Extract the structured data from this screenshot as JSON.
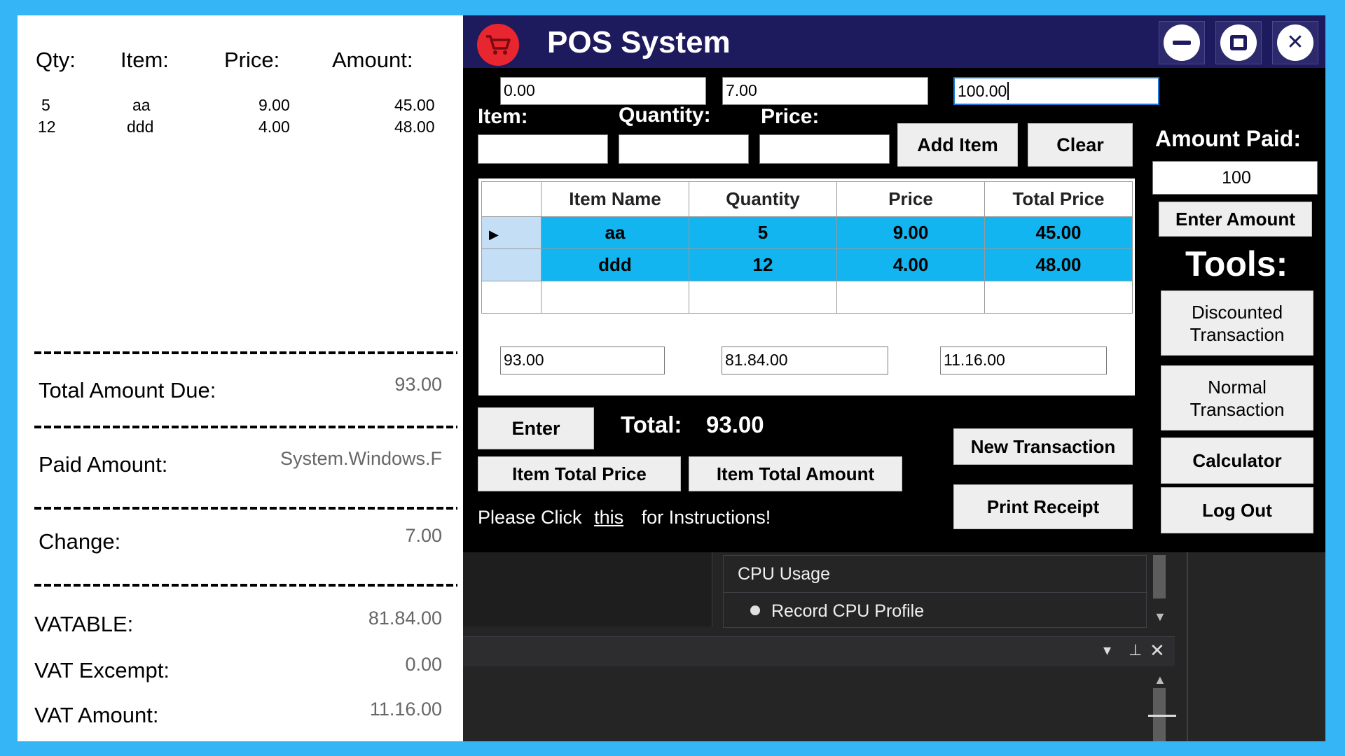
{
  "receipt": {
    "headers": {
      "qty": "Qty:",
      "item": "Item:",
      "price": "Price:",
      "amount": "Amount:"
    },
    "lines": [
      {
        "qty": "5",
        "item": "aa",
        "price": "9.00",
        "amount": "45.00"
      },
      {
        "qty": "12",
        "item": "ddd",
        "price": "4.00",
        "amount": "48.00"
      }
    ],
    "total_due_label": "Total Amount Due:",
    "total_due_value": "93.00",
    "paid_label": "Paid Amount:",
    "paid_value": "System.Windows.F",
    "change_label": "Change:",
    "change_value": "7.00",
    "vatable_label": "VATABLE:",
    "vatable_value": "81.84.00",
    "vat_exempt_label": "VAT Excempt:",
    "vat_exempt_value": "0.00",
    "vat_amount_label": "VAT Amount:",
    "vat_amount_value": "11.16.00"
  },
  "window": {
    "title": "POS System",
    "top_fields": [
      "0.00",
      "7.00",
      "100.00"
    ],
    "labels": {
      "item": "Item:",
      "quantity": "Quantity:",
      "price": "Price:",
      "amount_paid": "Amount Paid:",
      "tools": "Tools:",
      "total": "Total:"
    },
    "inputs": {
      "item": "",
      "quantity": "",
      "price": "",
      "amount_paid": "100"
    },
    "buttons": {
      "add_item": "Add Item",
      "clear": "Clear",
      "enter_amount": "Enter Amount",
      "discounted": "Discounted\nTransaction",
      "normal": "Normal\nTransaction",
      "calculator": "Calculator",
      "logout": "Log Out",
      "enter": "Enter",
      "item_total_price": "Item Total Price",
      "item_total_amount": "Item Total Amount",
      "new_transaction": "New Transaction",
      "print_receipt": "Print Receipt"
    },
    "grid": {
      "columns": [
        "Item Name",
        "Quantity",
        "Price",
        "Total Price"
      ],
      "rows": [
        [
          "aa",
          "5",
          "9.00",
          "45.00"
        ],
        [
          "ddd",
          "12",
          "4.00",
          "48.00"
        ]
      ]
    },
    "summary_fields": [
      "93.00",
      "81.84.00",
      "11.16.00"
    ],
    "total_value": "93.00",
    "instructions": {
      "prefix": "Please Click",
      "link": "this",
      "suffix": "for Instructions!"
    }
  },
  "background": {
    "cpu_usage": "CPU Usage",
    "record_cpu": "Record CPU Profile"
  }
}
